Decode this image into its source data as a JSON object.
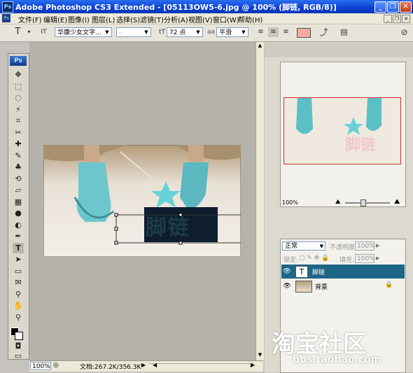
{
  "window": {
    "title": "Adobe Photoshop CS3 Extended - [05113OW5-6.jpg @ 100% (脚链, RGB/8)]",
    "app_icon": "Ps",
    "buttons": [
      "minimize-icon",
      "restore-icon",
      "close-icon"
    ]
  },
  "menubar": {
    "items": [
      "文件(F)",
      "编辑(E)",
      "图像(I)",
      "图层(L)",
      "选择(S)",
      "滤镜(T)",
      "分析(A)",
      "视图(V)",
      "窗口(W)",
      "帮助(H)"
    ]
  },
  "options": {
    "tool_glyph": "T",
    "orient_glyph": "IT",
    "font_family": "华康少女文字...",
    "font_style": "-",
    "size_icon_glyph": "tT",
    "font_size": "72 点",
    "aa_glyph": "aa",
    "anti_alias": "平滑",
    "text_color": "#f3a9a4"
  },
  "canvas": {
    "text_layer_content": "脚链",
    "text_color": "#1d3c48"
  },
  "toolbox": {
    "logo": "Ps",
    "tools": [
      "move-icon",
      "marquee-icon",
      "lasso-icon",
      "magic-wand-icon",
      "crop-icon",
      "slice-icon",
      "healing-icon",
      "brush-icon",
      "stamp-icon",
      "history-brush-icon",
      "eraser-icon",
      "gradient-icon",
      "blur-icon",
      "dodge-icon",
      "pen-icon",
      "type-icon",
      "path-select-icon",
      "shape-icon",
      "notes-icon",
      "eyedropper-icon",
      "hand-icon",
      "zoom-icon"
    ]
  },
  "status": {
    "zoom": "100%",
    "doc_info": "文档:267.2K/356.3K"
  },
  "navigator": {
    "zoom": "100%",
    "preview_text": "脚链",
    "view_box_color": "#d0312d"
  },
  "layers": {
    "blend_mode": "正常",
    "opacity_label": "不透明度:",
    "opacity_value": "100%",
    "lock_label": "锁定:",
    "fill_label": "填充:",
    "fill_value": "100%",
    "items": [
      {
        "name": "脚链",
        "thumb": "T",
        "selected": true
      },
      {
        "name": "背景",
        "thumb": "",
        "selected": false
      }
    ]
  },
  "watermark": {
    "logo": "淘宝社区",
    "url": "bbs.taobao.com"
  }
}
